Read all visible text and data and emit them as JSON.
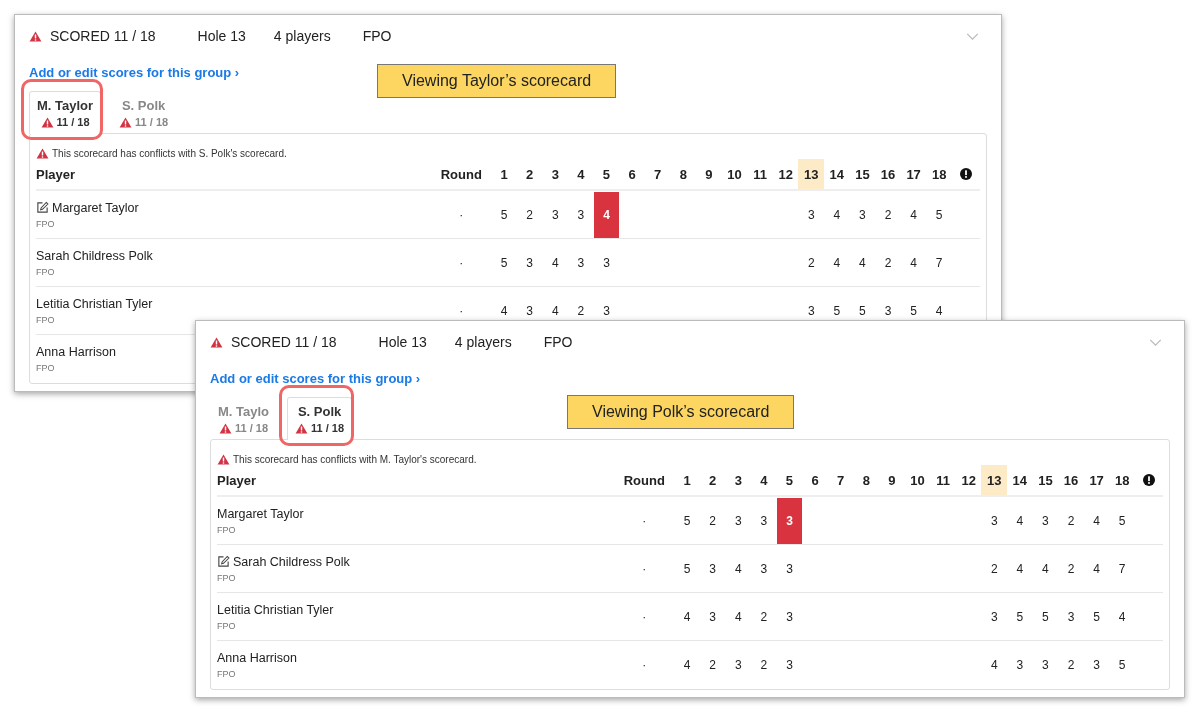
{
  "panels": [
    {
      "summary": {
        "scored": "SCORED 11 / 18",
        "hole": "Hole 13",
        "players": "4 players",
        "division": "FPO"
      },
      "link": "Add or edit scores for this group ›",
      "callout": "Viewing Taylor’s scorecard",
      "tabs": [
        {
          "label": "M. Taylor",
          "progress": "11 / 18",
          "selected": true,
          "highlighted": true
        },
        {
          "label": "S. Polk",
          "progress": "11 / 18",
          "selected": false,
          "highlighted": false
        }
      ],
      "conflict_note": "This scorecard has conflicts with S. Polk's scorecard.",
      "columns": {
        "player": "Player",
        "round": "Round",
        "holes": [
          {
            "label": "1",
            "selected": false
          },
          {
            "label": "2",
            "selected": false
          },
          {
            "label": "3",
            "selected": false
          },
          {
            "label": "4",
            "selected": false
          },
          {
            "label": "5",
            "selected": false
          },
          {
            "label": "6",
            "selected": false
          },
          {
            "label": "7",
            "selected": false
          },
          {
            "label": "8",
            "selected": false
          },
          {
            "label": "9",
            "selected": false
          },
          {
            "label": "10",
            "selected": false
          },
          {
            "label": "11",
            "selected": false
          },
          {
            "label": "12",
            "selected": false
          },
          {
            "label": "13",
            "selected": true
          },
          {
            "label": "14",
            "selected": false
          },
          {
            "label": "15",
            "selected": false
          },
          {
            "label": "16",
            "selected": false
          },
          {
            "label": "17",
            "selected": false
          },
          {
            "label": "18",
            "selected": false
          }
        ]
      },
      "rows": [
        {
          "name": "Margaret Taylor",
          "division": "FPO",
          "editing": true,
          "round": "·",
          "scores_front": [
            {
              "value": "5",
              "conflict": false
            },
            {
              "value": "2",
              "conflict": false
            },
            {
              "value": "3",
              "conflict": false
            },
            {
              "value": "3",
              "conflict": false
            },
            {
              "value": "4",
              "conflict": true
            }
          ],
          "scores_back": [
            {
              "value": "3",
              "conflict": false
            },
            {
              "value": "4",
              "conflict": false
            },
            {
              "value": "3",
              "conflict": false
            },
            {
              "value": "2",
              "conflict": false
            },
            {
              "value": "4",
              "conflict": false
            },
            {
              "value": "5",
              "conflict": false
            }
          ]
        },
        {
          "name": "Sarah Childress Polk",
          "division": "FPO",
          "editing": false,
          "round": "·",
          "scores_front": [
            {
              "value": "5",
              "conflict": false
            },
            {
              "value": "3",
              "conflict": false
            },
            {
              "value": "4",
              "conflict": false
            },
            {
              "value": "3",
              "conflict": false
            },
            {
              "value": "3",
              "conflict": false
            }
          ],
          "scores_back": [
            {
              "value": "2",
              "conflict": false
            },
            {
              "value": "4",
              "conflict": false
            },
            {
              "value": "4",
              "conflict": false
            },
            {
              "value": "2",
              "conflict": false
            },
            {
              "value": "4",
              "conflict": false
            },
            {
              "value": "7",
              "conflict": false
            }
          ]
        },
        {
          "name": "Letitia Christian Tyler",
          "division": "FPO",
          "editing": false,
          "round": "·",
          "scores_front": [
            {
              "value": "4",
              "conflict": false
            },
            {
              "value": "3",
              "conflict": false
            },
            {
              "value": "4",
              "conflict": false
            },
            {
              "value": "2",
              "conflict": false
            },
            {
              "value": "3",
              "conflict": false
            }
          ],
          "scores_back": [
            {
              "value": "3",
              "conflict": false
            },
            {
              "value": "5",
              "conflict": false
            },
            {
              "value": "5",
              "conflict": false
            },
            {
              "value": "3",
              "conflict": false
            },
            {
              "value": "5",
              "conflict": false
            },
            {
              "value": "4",
              "conflict": false
            }
          ]
        },
        {
          "name": "Anna Harrison",
          "division": "FPO",
          "editing": false
        }
      ]
    },
    {
      "summary": {
        "scored": "SCORED 11 / 18",
        "hole": "Hole 13",
        "players": "4 players",
        "division": "FPO"
      },
      "link": "Add or edit scores for this group ›",
      "callout": "Viewing Polk’s scorecard",
      "tabs": [
        {
          "label": "M. Taylo",
          "progress": "11 / 18",
          "selected": false,
          "highlighted": false
        },
        {
          "label": "S. Polk",
          "progress": "11 / 18",
          "selected": true,
          "highlighted": true
        }
      ],
      "conflict_note": "This scorecard has conflicts with M. Taylor's scorecard.",
      "columns": {
        "player": "Player",
        "round": "Round",
        "holes": [
          {
            "label": "1",
            "selected": false
          },
          {
            "label": "2",
            "selected": false
          },
          {
            "label": "3",
            "selected": false
          },
          {
            "label": "4",
            "selected": false
          },
          {
            "label": "5",
            "selected": false
          },
          {
            "label": "6",
            "selected": false
          },
          {
            "label": "7",
            "selected": false
          },
          {
            "label": "8",
            "selected": false
          },
          {
            "label": "9",
            "selected": false
          },
          {
            "label": "10",
            "selected": false
          },
          {
            "label": "11",
            "selected": false
          },
          {
            "label": "12",
            "selected": false
          },
          {
            "label": "13",
            "selected": true
          },
          {
            "label": "14",
            "selected": false
          },
          {
            "label": "15",
            "selected": false
          },
          {
            "label": "16",
            "selected": false
          },
          {
            "label": "17",
            "selected": false
          },
          {
            "label": "18",
            "selected": false
          }
        ]
      },
      "rows": [
        {
          "name": "Margaret Taylor",
          "division": "FPO",
          "editing": false,
          "round": "·",
          "scores_front": [
            {
              "value": "5",
              "conflict": false
            },
            {
              "value": "2",
              "conflict": false
            },
            {
              "value": "3",
              "conflict": false
            },
            {
              "value": "3",
              "conflict": false
            },
            {
              "value": "3",
              "conflict": true
            }
          ],
          "scores_back": [
            {
              "value": "3",
              "conflict": false
            },
            {
              "value": "4",
              "conflict": false
            },
            {
              "value": "3",
              "conflict": false
            },
            {
              "value": "2",
              "conflict": false
            },
            {
              "value": "4",
              "conflict": false
            },
            {
              "value": "5",
              "conflict": false
            }
          ]
        },
        {
          "name": "Sarah Childress Polk",
          "division": "FPO",
          "editing": true,
          "round": "·",
          "scores_front": [
            {
              "value": "5",
              "conflict": false
            },
            {
              "value": "3",
              "conflict": false
            },
            {
              "value": "4",
              "conflict": false
            },
            {
              "value": "3",
              "conflict": false
            },
            {
              "value": "3",
              "conflict": false
            }
          ],
          "scores_back": [
            {
              "value": "2",
              "conflict": false
            },
            {
              "value": "4",
              "conflict": false
            },
            {
              "value": "4",
              "conflict": false
            },
            {
              "value": "2",
              "conflict": false
            },
            {
              "value": "4",
              "conflict": false
            },
            {
              "value": "7",
              "conflict": false
            }
          ]
        },
        {
          "name": "Letitia Christian Tyler",
          "division": "FPO",
          "editing": false,
          "round": "·",
          "scores_front": [
            {
              "value": "4",
              "conflict": false
            },
            {
              "value": "3",
              "conflict": false
            },
            {
              "value": "4",
              "conflict": false
            },
            {
              "value": "2",
              "conflict": false
            },
            {
              "value": "3",
              "conflict": false
            }
          ],
          "scores_back": [
            {
              "value": "3",
              "conflict": false
            },
            {
              "value": "5",
              "conflict": false
            },
            {
              "value": "5",
              "conflict": false
            },
            {
              "value": "3",
              "conflict": false
            },
            {
              "value": "5",
              "conflict": false
            },
            {
              "value": "4",
              "conflict": false
            }
          ]
        },
        {
          "name": "Anna Harrison",
          "division": "FPO",
          "editing": false,
          "round": "·",
          "scores_front": [
            {
              "value": "4",
              "conflict": false
            },
            {
              "value": "2",
              "conflict": false
            },
            {
              "value": "3",
              "conflict": false
            },
            {
              "value": "2",
              "conflict": false
            },
            {
              "value": "3",
              "conflict": false
            }
          ],
          "scores_back": [
            {
              "value": "4",
              "conflict": false
            },
            {
              "value": "3",
              "conflict": false
            },
            {
              "value": "3",
              "conflict": false
            },
            {
              "value": "2",
              "conflict": false
            },
            {
              "value": "3",
              "conflict": false
            },
            {
              "value": "5",
              "conflict": false
            }
          ]
        }
      ]
    }
  ]
}
